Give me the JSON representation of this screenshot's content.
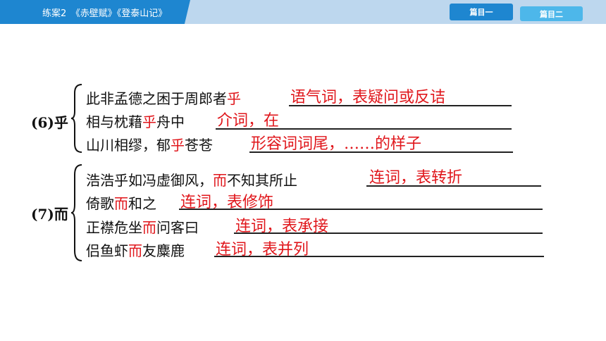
{
  "header": {
    "title": "练案2　《赤壁赋》《登泰山记》",
    "tabs": [
      {
        "label": "篇目一",
        "active": true
      },
      {
        "label": "篇目二",
        "active": false
      }
    ]
  },
  "colors": {
    "accent": "#1e86d0",
    "bar": "#bdd7ee",
    "answer": "#e0161b"
  },
  "groups": [
    {
      "label": "(6)乎",
      "items": [
        {
          "pre": "此非孟德之困于周郎者",
          "mark": "乎",
          "post": "",
          "answer": "语气词，表疑问或反诘"
        },
        {
          "pre": "相与枕藉",
          "mark": "乎",
          "post": "舟中",
          "answer": "介词，在"
        },
        {
          "pre": "山川相缪，郁",
          "mark": "乎",
          "post": "苍苍",
          "answer": "形容词词尾，……的样子"
        }
      ]
    },
    {
      "label": "(7)而",
      "items": [
        {
          "pre": "浩浩乎如冯虚御风，",
          "mark": "而",
          "post": "不知其所止",
          "answer": "连词，表转折"
        },
        {
          "pre": "倚歌",
          "mark": "而",
          "post": "和之",
          "answer": "连词，表修饰"
        },
        {
          "pre": "正襟危坐",
          "mark": "而",
          "post": "问客曰",
          "answer": "连词，表承接"
        },
        {
          "pre": "侣鱼虾",
          "mark": "而",
          "post": "友麋鹿",
          "answer": "连词，表并列"
        }
      ]
    }
  ]
}
